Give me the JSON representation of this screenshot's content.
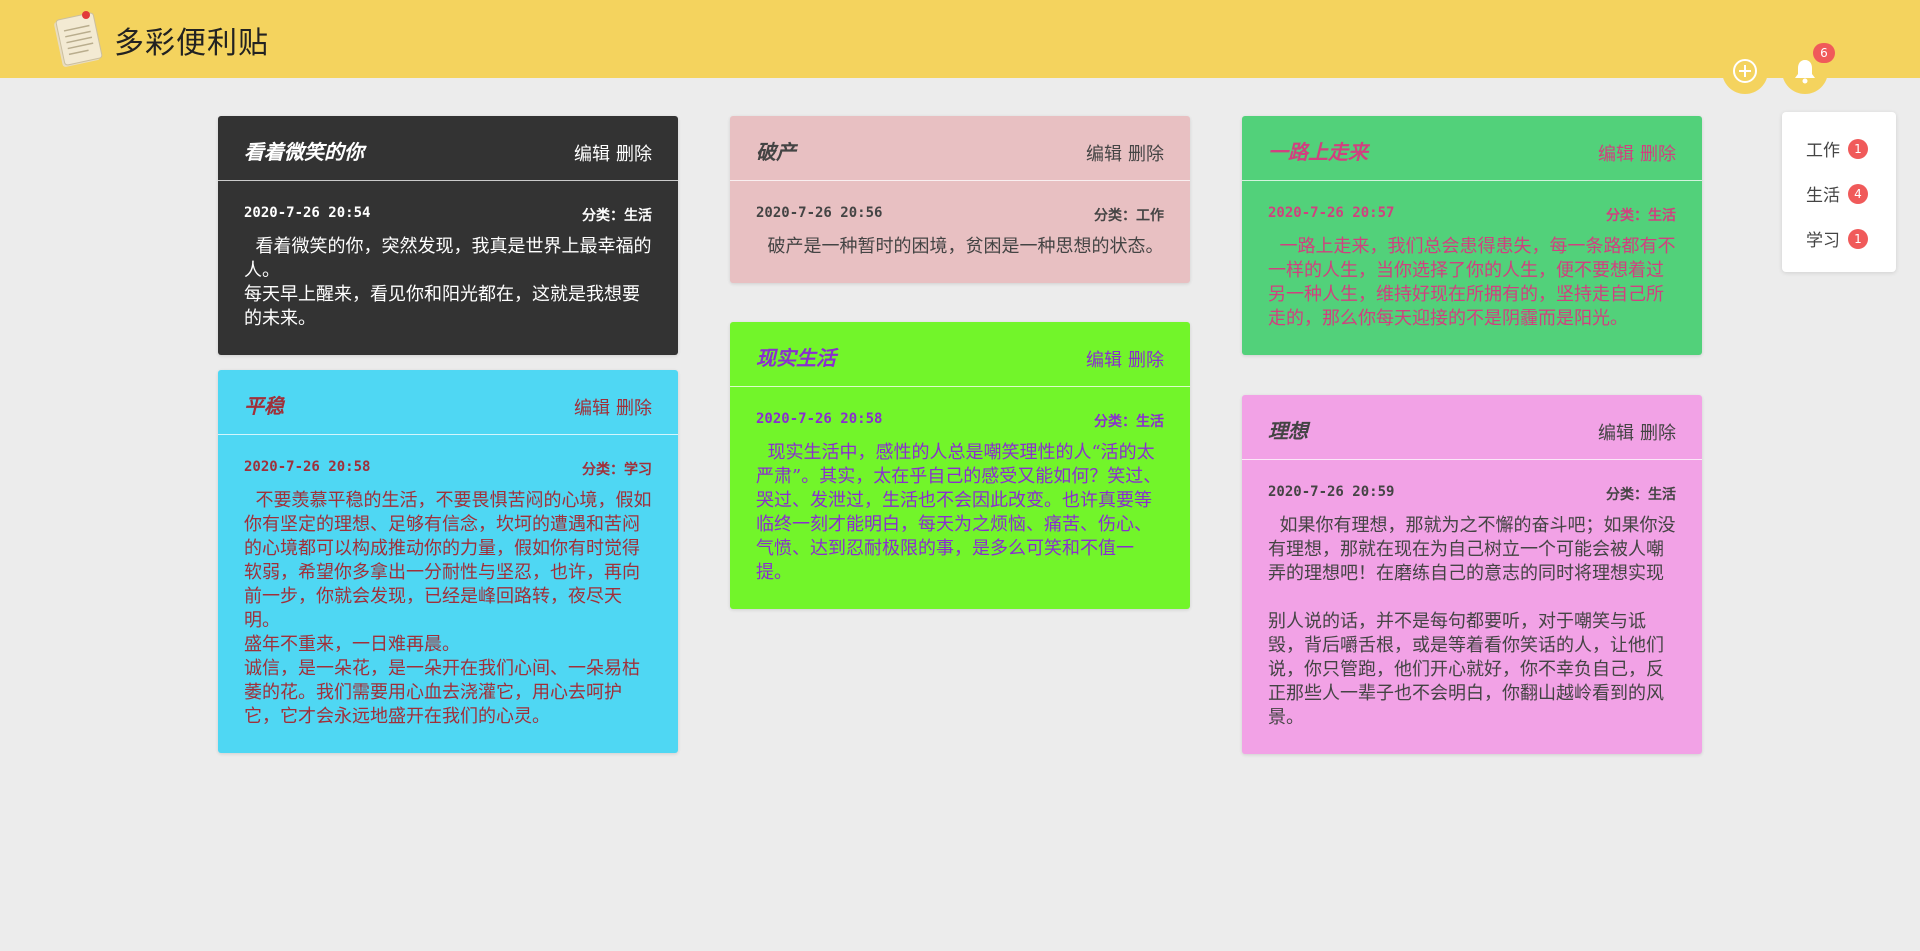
{
  "app": {
    "title": "多彩便利贴",
    "notification_count": "6"
  },
  "categories": [
    {
      "label": "工作",
      "count": "1"
    },
    {
      "label": "生活",
      "count": "4"
    },
    {
      "label": "学习",
      "count": "1"
    }
  ],
  "actions": {
    "edit": "编辑",
    "delete": "删除"
  },
  "notes": [
    {
      "title": "看着微笑的你",
      "date": "2020-7-26 20:54",
      "category": "分类：生活",
      "content": "  看着微笑的你，突然发现，我真是世界上最幸福的人。\n每天早上醒来，看见你和阳光都在，这就是我想要的未来。",
      "bg": "#333333",
      "fg": "#ffffff"
    },
    {
      "title": "平稳",
      "date": "2020-7-26 20:58",
      "category": "分类：学习",
      "content": "  不要羡慕平稳的生活，不要畏惧苦闷的心境，假如你有坚定的理想、足够有信念，坎坷的遭遇和苦闷的心境都可以构成推动你的力量，假如你有时觉得软弱，希望你多拿出一分耐性与坚忍，也许，再向前一步，你就会发现，已经是峰回路转，夜尽天明。\n盛年不重来，一日难再晨。\n诚信，是一朵花，是一朵开在我们心间、一朵易枯萎的花。我们需要用心血去浇灌它，用心去呵护它，它才会永远地盛开在我们的心灵。",
      "bg": "#4fd7f3",
      "fg": "#a0303a"
    },
    {
      "title": "破产",
      "date": "2020-7-26 20:56",
      "category": "分类：工作",
      "content": "  破产是一种暂时的困境，贫困是一种思想的状态。",
      "bg": "#e8c0c2",
      "fg": "#444444"
    },
    {
      "title": "现实生活",
      "date": "2020-7-26 20:58",
      "category": "分类：生活",
      "content": "  现实生活中，感性的人总是嘲笑理性的人“活的太严肃”。其实，太在乎自己的感受又能如何？笑过、哭过、发泄过，生活也不会因此改变。也许真要等临终一刻才能明白，每天为之烦恼、痛苦、伤心、气愤、达到忍耐极限的事，是多么可笑和不值一提。",
      "bg": "#72f52a",
      "fg": "#8a2ecf"
    },
    {
      "title": "一路上走来",
      "date": "2020-7-26 20:57",
      "category": "分类：生活",
      "content": "  一路上走来，我们总会患得患失，每一条路都有不一样的人生，当你选择了你的人生，便不要想着过另一种人生，维持好现在所拥有的，坚持走自己所走的，那么你每天迎接的不是阴霾而是阳光。",
      "bg": "#52d17a",
      "fg": "#d0417f"
    },
    {
      "title": "理想",
      "date": "2020-7-26 20:59",
      "category": "分类：生活",
      "content": "  如果你有理想，那就为之不懈的奋斗吧；如果你没有理想，那就在现在为自己树立一个可能会被人嘲弄的理想吧！在磨练自己的意志的同时将理想实现\n\n别人说的话，并不是每句都要听，对于嘲笑与诋毁，背后嚼舌根，或是等着看你笑话的人，让他们说，你只管跑，他们开心就好，你不幸负自己，反正那些人一辈子也不会明白，你翻山越岭看到的风景。",
      "bg": "#f2a2e6",
      "fg": "#444444"
    }
  ]
}
